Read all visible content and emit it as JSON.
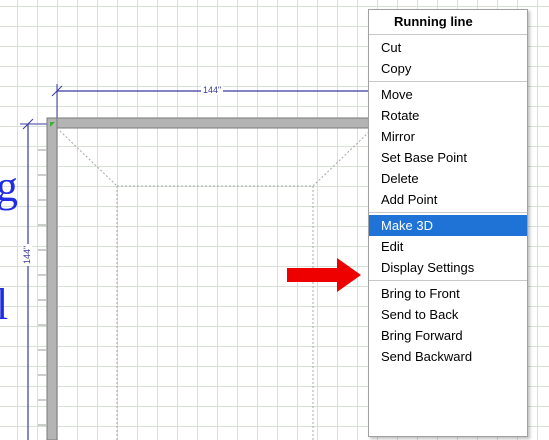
{
  "canvas": {
    "dimension_horizontal": "144\"",
    "dimension_vertical": "144\"",
    "side_letters": [
      "g",
      "l"
    ]
  },
  "context_menu": {
    "title": "Running line",
    "groups": [
      [
        "Cut",
        "Copy"
      ],
      [
        "Move",
        "Rotate",
        "Mirror",
        "Set Base Point",
        "Delete",
        "Add Point"
      ],
      [
        "Make 3D",
        "Edit",
        "Display Settings"
      ],
      [
        "Bring to Front",
        "Send to Back",
        "Bring Forward",
        "Send Backward"
      ]
    ],
    "selected_item": "Make 3D"
  },
  "colors": {
    "grid": "#d6e2d6",
    "wall": "#b4b4b4",
    "dimension_line": "#3a3aa0",
    "menu_highlight": "#1f73d6",
    "arrow": "#ee0000",
    "side_text": "#1f2ee0"
  }
}
